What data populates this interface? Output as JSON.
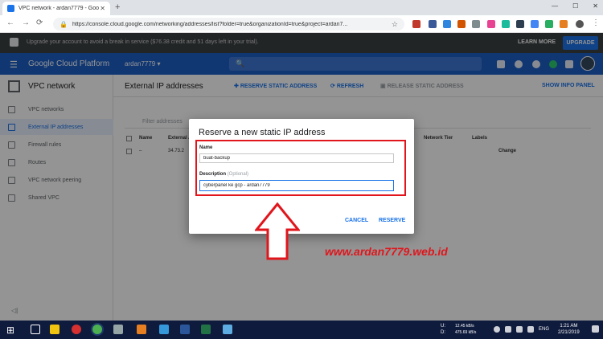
{
  "browser": {
    "tab_title": "VPC network - ardan7779 - Goo",
    "tab_close": "✕",
    "new_tab": "+",
    "url": "https://console.cloud.google.com/networking/addresses/list?folder=true&organizationId=true&project=ardan7...",
    "window_controls": [
      "—",
      "☐",
      "✕"
    ]
  },
  "banner": {
    "message": "Upgrade your account to avoid a break in service ($76.38 credit and 51 days left in your trial).",
    "learn_more": "LEARN MORE",
    "upgrade": "UPGRADE"
  },
  "header": {
    "menu_icon": "☰",
    "brand": "Google Cloud Platform",
    "project": "ardan7779 ▾",
    "search_icon": "🔍"
  },
  "sidebar": {
    "title": "VPC network",
    "items": [
      {
        "label": "VPC networks",
        "icon": "vpc-networks-icon"
      },
      {
        "label": "External IP addresses",
        "icon": "external-ip-icon",
        "active": true
      },
      {
        "label": "Firewall rules",
        "icon": "firewall-icon"
      },
      {
        "label": "Routes",
        "icon": "routes-icon"
      },
      {
        "label": "VPC network peering",
        "icon": "peering-icon"
      },
      {
        "label": "Shared VPC",
        "icon": "shared-vpc-icon"
      }
    ],
    "collapse": "◁|"
  },
  "main": {
    "title": "External IP addresses",
    "reserve_static": "RESERVE STATIC ADDRESS",
    "refresh": "REFRESH",
    "release_static": "RELEASE STATIC ADDRESS",
    "show_info_panel": "SHOW INFO PANEL",
    "filter_placeholder": "Filter addresses",
    "columns": {
      "name": "Name",
      "external": "External A",
      "network_tier": "Network Tier",
      "labels": "Labels"
    },
    "row": {
      "name": "–",
      "address": "34.73.2",
      "action": "Change"
    }
  },
  "dialog": {
    "title": "Reserve a new static IP address",
    "name_label": "Name",
    "name_value": "buat-backup",
    "description_label": "Description",
    "description_optional": "(Optional)",
    "description_value": "cyberpanel ke gcp - ardan7779",
    "cancel": "CANCEL",
    "reserve": "RESERVE"
  },
  "watermark": "www.ardan7779.web.id",
  "taskbar": {
    "start_icon": "⊞",
    "upload_label": "U:",
    "download_label": "D:",
    "upload_speed": "12.45 kB/s",
    "download_speed": "475.69 kB/s",
    "language": "ENG",
    "time": "1:21 AM",
    "date": "2/21/2019"
  },
  "colors": {
    "gcp_blue": "#1e5fc7",
    "accent_blue": "#1a73e8",
    "annotation_red": "#e0161c"
  }
}
